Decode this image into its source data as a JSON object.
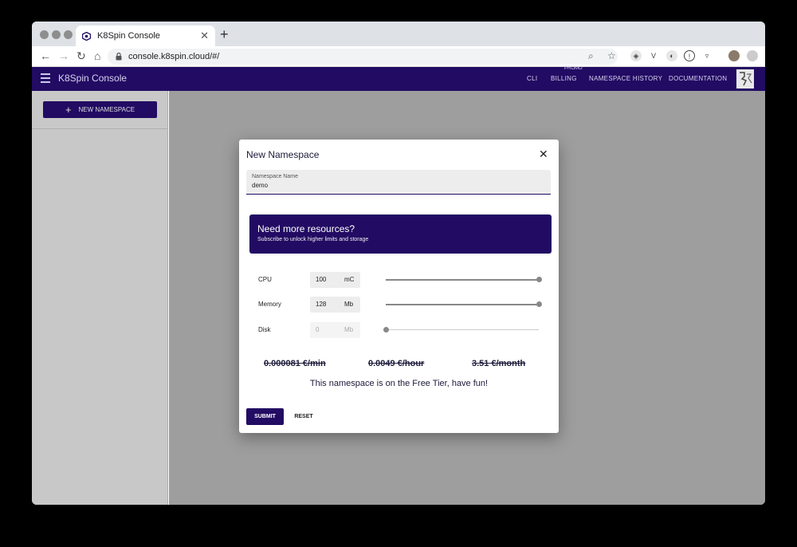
{
  "browser": {
    "tab_title": "K8Spin Console",
    "url": "console.k8spin.cloud/#/"
  },
  "appbar": {
    "title": "K8Spin Console",
    "nav": [
      "CLI",
      "BILLING",
      "NAMESPACE HISTORY",
      "DOCUMENTATION"
    ],
    "billing_badge": "PROMO"
  },
  "sidebar": {
    "new_namespace_label": "NEW NAMESPACE"
  },
  "modal": {
    "title": "New Namespace",
    "namespace_field": {
      "label": "Namespace Name",
      "value": "demo"
    },
    "banner": {
      "title": "Need more resources?",
      "subtitle": "Subscribe to unlock higher limits and storage"
    },
    "resources": [
      {
        "label": "CPU",
        "value": "100",
        "unit": "mC",
        "slider_fraction": 1.0,
        "enabled": true
      },
      {
        "label": "Memory",
        "value": "128",
        "unit": "Mb",
        "slider_fraction": 1.0,
        "enabled": true
      },
      {
        "label": "Disk",
        "value": "0",
        "unit": "Mb",
        "slider_fraction": 0.0,
        "enabled": false
      }
    ],
    "prices": [
      "0.000081 €/min",
      "0.0049 €/hour",
      "3.51 €/month"
    ],
    "free_tier_message": "This namespace is on the Free Tier, have fun!",
    "submit_label": "SUBMIT",
    "reset_label": "RESET"
  },
  "colors": {
    "brand": "#220b63",
    "overlay": "#9e9e9e"
  }
}
